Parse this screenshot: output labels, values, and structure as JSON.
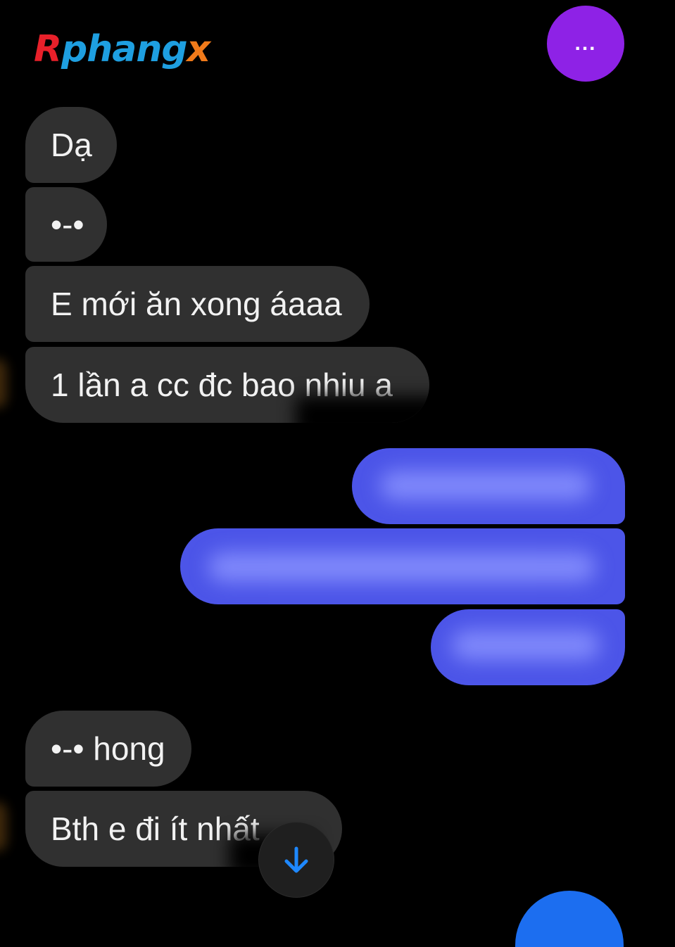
{
  "logo": {
    "part1": "R",
    "part2": "phang",
    "part3": "x"
  },
  "header": {
    "more_label": "..."
  },
  "messages_received": [
    {
      "text": "Dạ"
    },
    {
      "text": "•-•"
    },
    {
      "text": "E mới ăn xong áaaa"
    },
    {
      "text": "1 lần a cc đc bao nhiu a"
    },
    {
      "text": "•-• hong"
    },
    {
      "text": "Bth e đi ít nhất"
    }
  ],
  "colors": {
    "received_bubble": "#303030",
    "sent_bubble": "#4c55e8",
    "more_button": "#8e22e6",
    "scroll_arrow": "#1e88ff",
    "bottom_bubble": "#1c6ef0"
  },
  "icons": {
    "scroll_down": "arrow-down-icon",
    "more": "more-dots-icon"
  }
}
